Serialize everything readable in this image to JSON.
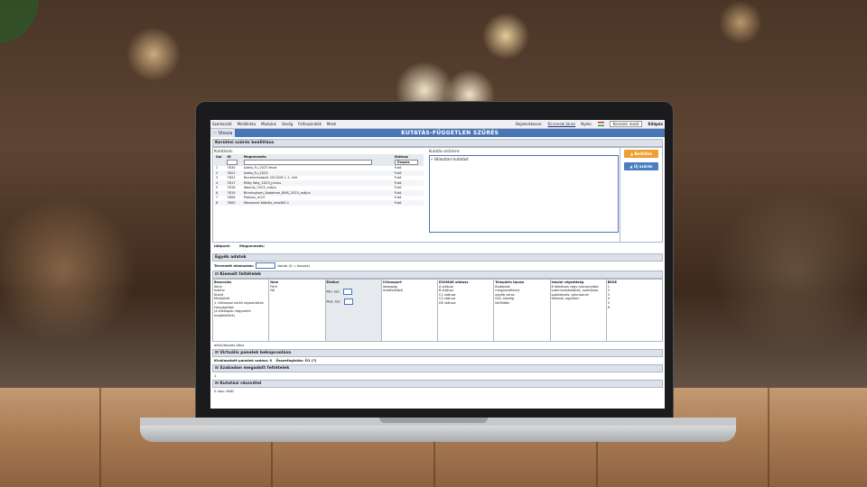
{
  "menu": {
    "items": [
      "Szerkesztő",
      "Mellékleta",
      "Modulok",
      "Vevőg",
      "Felhasználók",
      "Mesh"
    ],
    "user_label": "Bejelentkezve:",
    "user": "Kincsesbi János",
    "lang": "Nyelv:",
    "search_btn": "Keresési mező",
    "logout": "Kilépés"
  },
  "header": {
    "back": "Vissza",
    "title": "KUTATÁS-FÜGGETLEN SZŰRÉS"
  },
  "section1": {
    "title": "Kerülési szűrés beállítása",
    "kutatasok": "Kutatások:",
    "right_label": "Kutatás szűrésre:",
    "selected": "» Választani kutatást",
    "col_sor": "Sor",
    "col_id": "ID",
    "col_name": "Megnevezés",
    "col_status": "Státusz",
    "status_select": "Összes",
    "rows": [
      {
        "sor": "1",
        "id": "7830",
        "name": "Szeta_Fu_2023 teszt",
        "status": "Futó"
      },
      {
        "sor": "2",
        "id": "7821",
        "name": "Szeta_Fu_2023",
        "status": "Futó"
      },
      {
        "sor": "3",
        "id": "7822",
        "name": "Novemeestajok 2023/06 1-1- hét",
        "status": "Futó"
      },
      {
        "sor": "4",
        "id": "7817",
        "name": "Milky Way_2023_június",
        "status": "Futó"
      },
      {
        "sor": "5",
        "id": "7818",
        "name": "Ideanis_2023_május",
        "status": "Futó"
      },
      {
        "sor": "6",
        "id": "7819",
        "name": "Birmingham_Vodafone_BMS_2023_május",
        "status": "Futó"
      },
      {
        "sor": "7",
        "id": "7808",
        "name": "Plateau_m23",
        "status": "Futó"
      },
      {
        "sor": "8",
        "id": "7805",
        "name": "Meszaresi Köbiöls_teszt63-1",
        "status": "Futó"
      }
    ]
  },
  "buttons": {
    "save": "Beállítás",
    "new_filter": "Új szűrés"
  },
  "footer1": {
    "idopont": "Időpont:",
    "megnevezes": "Megnevezés:"
  },
  "section2": {
    "title": "Egyéb adatok",
    "label": "Tervezett elemszám:",
    "unit": "darab (0 = összes)"
  },
  "section3": {
    "title": "Kiemelt feltételek",
    "cols": [
      {
        "h": "Besorolás",
        "lines": [
          "Aktív",
          "Inaktív",
          "Kivett",
          "",
          "Minősített",
          "1. klikkapon belüli regisztráltak",
          "Hanyagoltak",
          "(A klikkapok négyzeten megfelelőek)"
        ]
      },
      {
        "h": "Nem",
        "lines": [
          "Férfi",
          "Nő"
        ]
      },
      {
        "h": "Életkor",
        "lines": [
          "Min. kor:",
          "Max. kor:"
        ]
      },
      {
        "h": "Célcsoport",
        "lines": [
          "lakossági",
          "üzletfelelőző"
        ]
      },
      {
        "h": "ESOMAR státusz",
        "lines": [
          "A státusz",
          "B státusz",
          "C1 státusz",
          "C2 státusz",
          "DE státusz"
        ]
      },
      {
        "h": "Település típusa",
        "lines": [
          "Budapest",
          "megyeszékhely",
          "egyéb város",
          "falu, község",
          "külföldön"
        ]
      },
      {
        "h": "Iskolai végzettség",
        "lines": [
          "8 általános vagy alacsonyabb",
          "szakmunkásképző, szakiskola",
          "szakképzés, gimnázium",
          "főiskola, egyetem"
        ]
      },
      {
        "h": "BEGE",
        "lines": [
          "1",
          "2",
          "3",
          "4",
          "5",
          "6"
        ]
      }
    ],
    "note": "aktív/összes látsz"
  },
  "section4": {
    "title": "Virtuális panelek bekapcsolása",
    "count_label": "Kiválasztott panelek száma: 0",
    "sum_label": "Összefoglalás: Ö1 (?)"
  },
  "section5": {
    "title": "Szabadon megadott feltételek",
    "value": "1"
  },
  "section6": {
    "title": "Kutatási részvétel",
    "value": "0 nap: AND"
  },
  "colors": {
    "accent": "#4a76b7",
    "orange": "#f0a030",
    "blue_btn": "#4a7ec0"
  }
}
